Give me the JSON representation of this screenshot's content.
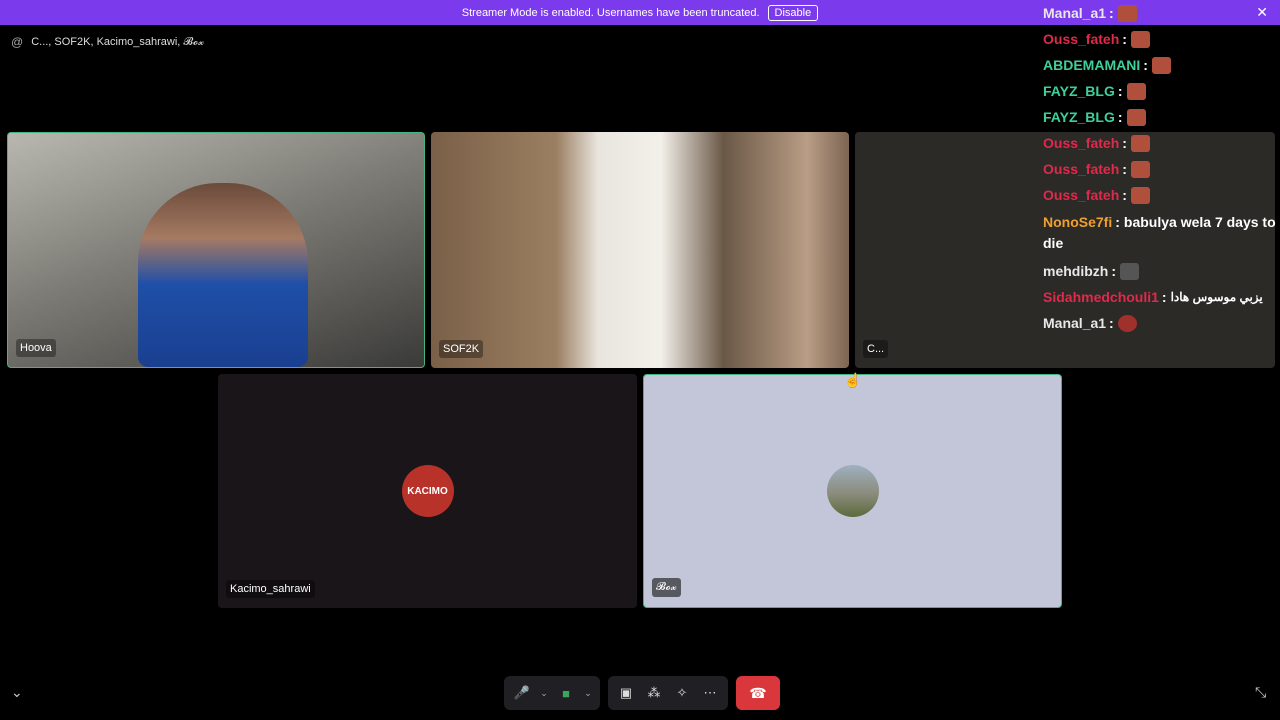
{
  "banner": {
    "text": "Streamer Mode is enabled. Usernames have been truncated.",
    "disable_label": "Disable",
    "close_icon": "✕"
  },
  "call": {
    "at_icon": "@",
    "participants": "C..., SOF2K, Kacimo_sahrawi, 𝓑𝓸𝔁"
  },
  "tiles": [
    {
      "name": "Hoova"
    },
    {
      "name": "SOF2K"
    },
    {
      "name": "C..."
    },
    {
      "name": "Kacimo_sahrawi",
      "avatar_text": "KACIMO"
    },
    {
      "name": "𝓑𝓸𝔁"
    }
  ],
  "chat": [
    {
      "user": "Manal_a1",
      "sep": ":",
      "text": "",
      "color": "#e8e8e8"
    },
    {
      "user": "Ouss_fateh",
      "sep": ":",
      "text": "",
      "color": "#e0294b"
    },
    {
      "user": "ABDEMAMANI",
      "sep": ":",
      "text": "",
      "color": "#3fcf9a"
    },
    {
      "user": "FAYZ_BLG",
      "sep": ":",
      "text": "",
      "color": "#3fcf9a"
    },
    {
      "user": "FAYZ_BLG",
      "sep": ":",
      "text": "",
      "color": "#3fcf9a"
    },
    {
      "user": "Ouss_fateh",
      "sep": ":",
      "text": "",
      "color": "#e0294b"
    },
    {
      "user": "Ouss_fateh",
      "sep": ":",
      "text": "",
      "color": "#e0294b"
    },
    {
      "user": "Ouss_fateh",
      "sep": ":",
      "text": "",
      "color": "#e0294b"
    },
    {
      "user": "NonoSe7fi",
      "sep": ":",
      "text": "babulya wela 7 days to die",
      "color": "#f0a030"
    },
    {
      "user": "mehdibzh",
      "sep": ":",
      "text": "",
      "color": "#e8e8e8"
    },
    {
      "user": "Sidahmedchouli1",
      "sep": ":",
      "text": "يزبي موسوس هادا",
      "color": "#e0294b"
    },
    {
      "user": "Manal_a1",
      "sep": ":",
      "text": "",
      "color": "#e8e8e8"
    }
  ],
  "controls": {
    "mic_icon": "🎤",
    "chevron_icon": "⌄",
    "camera_icon": "■",
    "screen_icon": "▣",
    "activity_icon": "⁂",
    "soundboard_icon": "✧",
    "more_icon": "⋯",
    "hangup_icon": "☎",
    "collapse_icon": "⌄",
    "minimize_icon": "⤡"
  }
}
